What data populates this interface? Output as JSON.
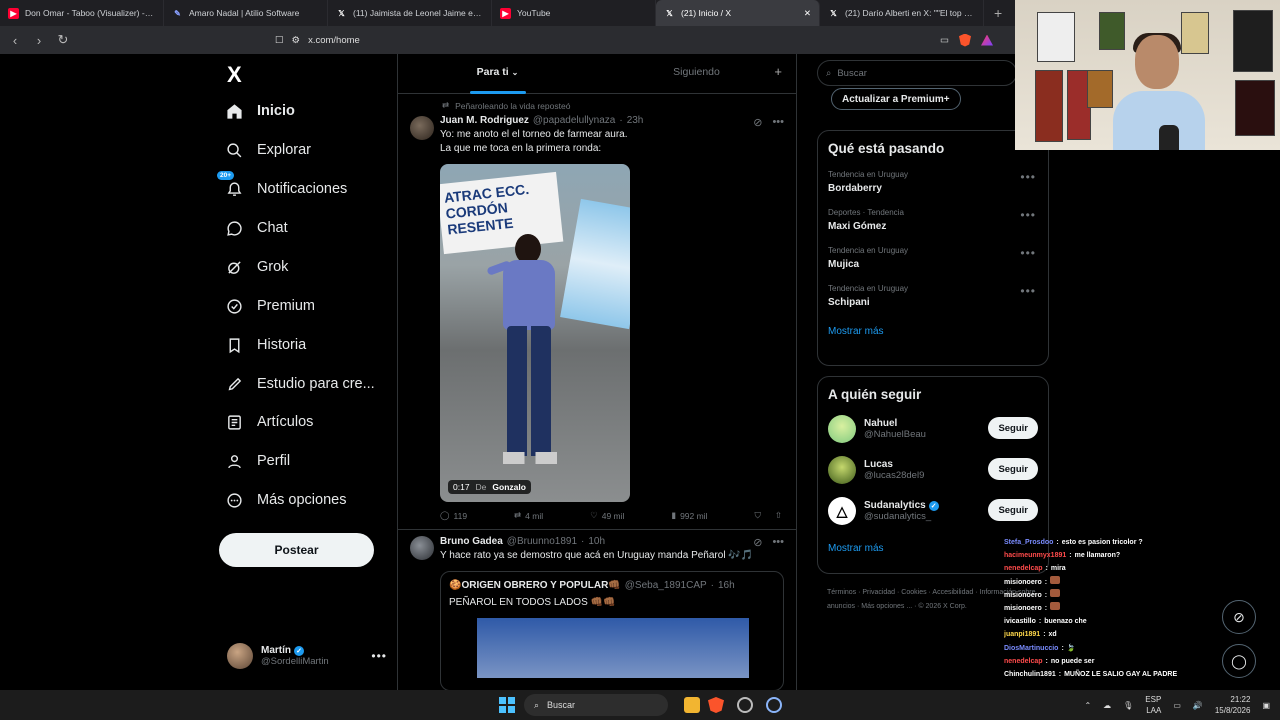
{
  "browser": {
    "tabs": [
      {
        "label": "Don Omar - Taboo (Visualizer) - YouT",
        "icon": "youtube-icon"
      },
      {
        "label": "Amaro Nadal | Atilio Software",
        "icon": "atilio-icon"
      },
      {
        "label": "(11) Jaimista de Leonel Jaime en X: \"I",
        "icon": "x-icon"
      },
      {
        "label": "YouTube",
        "icon": "youtube-icon"
      },
      {
        "label": "(21) Inicio / X",
        "icon": "x-icon"
      },
      {
        "label": "(21) Darío Alberti en X: \"\"El top 3 de",
        "icon": "x-icon"
      }
    ],
    "url": "x.com/home"
  },
  "nav": {
    "logo": "X",
    "items": [
      {
        "label": "Inicio",
        "icon": "home-icon",
        "bold": true
      },
      {
        "label": "Explorar",
        "icon": "search-icon"
      },
      {
        "label": "Notificaciones",
        "icon": "bell-icon",
        "badge": "20+"
      },
      {
        "label": "Chat",
        "icon": "chat-icon"
      },
      {
        "label": "Grok",
        "icon": "grok-icon"
      },
      {
        "label": "Premium",
        "icon": "premium-icon"
      },
      {
        "label": "Historia",
        "icon": "bookmark-icon"
      },
      {
        "label": "Estudio para cre...",
        "icon": "rocket-icon"
      },
      {
        "label": "Artículos",
        "icon": "article-icon"
      },
      {
        "label": "Perfil",
        "icon": "person-icon"
      },
      {
        "label": "Más opciones",
        "icon": "more-icon"
      }
    ],
    "post_label": "Postear",
    "profile": {
      "name": "Martín",
      "handle": "@SordelliMartin"
    }
  },
  "feed": {
    "tabs": [
      "Para ti",
      "Siguiendo"
    ],
    "tweets": [
      {
        "repost_by": "Peñaroleando la vida reposteó",
        "name": "Juan M. Rodriguez",
        "handle": "@papadelullynaza",
        "time": "23h",
        "text_1": "Yo: me anoto el el torneo de farmear aura.",
        "text_2": "La que me toca en la primera ronda:",
        "video_time": "0:17",
        "video_from": "De",
        "video_author": "Gonzalo",
        "banner": "ATRAC ECC. CORDÓN RESENTE",
        "replies": "119",
        "reposts": "4 mil",
        "likes": "49 mil",
        "views": "992 mil"
      },
      {
        "name": "Bruno Gadea",
        "handle": "@Bruunno1891",
        "time": "10h",
        "text": "Y hace rato ya se demostro que acá en Uruguay manda Peñarol 🎶🎵",
        "quote_name": "🍪ORIGEN OBRERO Y POPULAR👊🏾",
        "quote_handle": "@Seba_1891CAP",
        "quote_time": "16h",
        "quote_text": "PEÑAROL EN TODOS LADOS 👊🏾👊🏾"
      }
    ]
  },
  "sidebar": {
    "search_placeholder": "Buscar",
    "premium_label": "Actualizar a Premium+",
    "trending_title": "Qué está pasando",
    "trends": [
      {
        "meta": "Tendencia en Uruguay",
        "name": "Bordaberry"
      },
      {
        "meta": "Deportes · Tendencia",
        "name": "Maxi Gómez"
      },
      {
        "meta": "Tendencia en Uruguay",
        "name": "Mujica"
      },
      {
        "meta": "Tendencia en Uruguay",
        "name": "Schipani"
      }
    ],
    "show_more": "Mostrar más",
    "follow_title": "A quién seguir",
    "follows": [
      {
        "name": "Nahuel",
        "handle": "@NahuelBeau",
        "verified": false,
        "color": "#7fc97f"
      },
      {
        "name": "Lucas",
        "handle": "@lucas28del9",
        "verified": false,
        "color": "#6b8e23"
      },
      {
        "name": "Sudanalytics",
        "handle": "@sudanalytics_",
        "verified": true,
        "color": "#ffffff"
      }
    ],
    "follow_label": "Seguir",
    "footer": "Términos · Privacidad · Cookies · Accesibilidad · Información sobre anuncios · Más opciones ... · © 2026 X Corp."
  },
  "stream_chat": [
    {
      "user": "Stefa_Prosdoo",
      "msg": "esto es pasion tricolor ?",
      "cls": "u"
    },
    {
      "user": "hacimeunmyx1891",
      "msg": "me llamaron?",
      "cls": "u red"
    },
    {
      "user": "nenedelcap",
      "msg": "mira",
      "cls": "u red"
    },
    {
      "user": "misionoero",
      "msg": "",
      "cls": "u wh",
      "emote": true
    },
    {
      "user": "misionoero",
      "msg": "",
      "cls": "u wh",
      "emote": true
    },
    {
      "user": "misionoero",
      "msg": "",
      "cls": "u wh",
      "emote": true
    },
    {
      "user": "ivicastillo",
      "msg": "buenazo che",
      "cls": "u wh"
    },
    {
      "user": "juanpi1891",
      "msg": "xd",
      "cls": "u yel"
    },
    {
      "user": "DiosMartinuccio",
      "msg": "🍃",
      "cls": "u"
    },
    {
      "user": "nenedelcap",
      "msg": "no puede ser",
      "cls": "u red"
    },
    {
      "user": "Chinchulin1891",
      "msg": "MUÑOZ LE SALIO GAY AL PADRE",
      "cls": "u wh"
    }
  ],
  "taskbar": {
    "search": "Buscar",
    "lang": "ESP",
    "lang2": "LAA",
    "time": "21:22",
    "date": "15/8/2026"
  },
  "colors": {
    "accent": "#1d9bf0",
    "background": "#000000",
    "border": "#2f3336"
  }
}
